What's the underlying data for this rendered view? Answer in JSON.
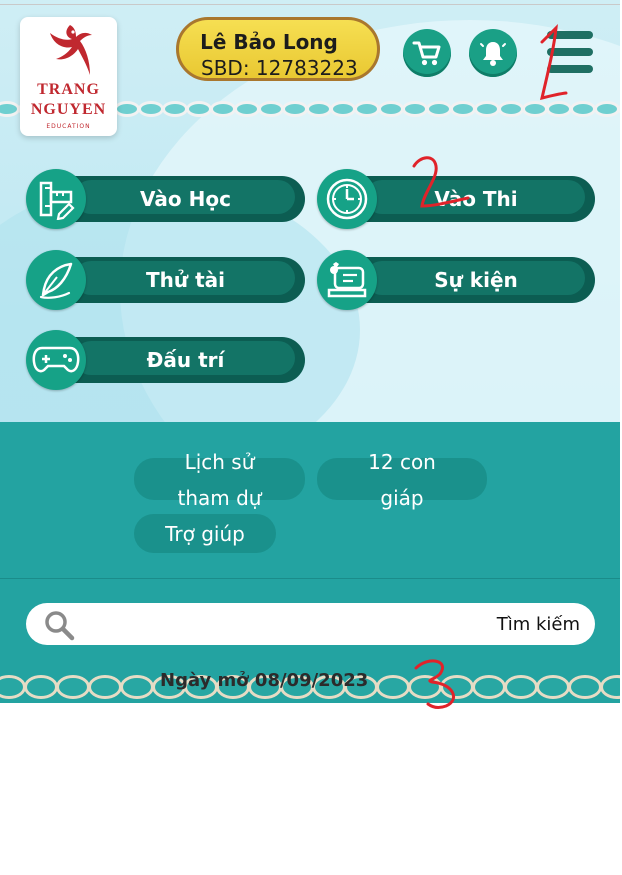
{
  "header": {
    "logo": {
      "line1": "TRANG",
      "line2": "NGUYEN",
      "line3": "EDUCATION"
    },
    "user": {
      "name": "Lê Bảo Long",
      "sbd": "SBD: 12783223"
    },
    "icons": [
      "cart-icon",
      "bell-icon",
      "hamburger-menu-icon"
    ]
  },
  "menu": {
    "items": [
      {
        "label": "Vào Học",
        "icon": "ruler-pencil-icon"
      },
      {
        "label": "Vào Thi",
        "icon": "clock-icon"
      },
      {
        "label": "Thử tài",
        "icon": "quill-icon"
      },
      {
        "label": "Sự kiện",
        "icon": "event-card-icon"
      },
      {
        "label": "Đấu trí",
        "icon": "gamepad-icon"
      }
    ]
  },
  "links": {
    "history_line1": "Lịch sử",
    "history_line2": "tham dự",
    "zodiac_line1": "12 con",
    "zodiac_line2": "giáp",
    "help": "Trợ giúp"
  },
  "search": {
    "placeholder": "Tìm kiếm"
  },
  "footer": {
    "date_text": "Ngày mở 08/09/2023"
  },
  "annotations": [
    "1",
    "2",
    "3"
  ],
  "colors": {
    "teal": "#23a3a1",
    "dark_green": "#0c5d52",
    "icon_green": "#16a287",
    "gold": "#f6df52",
    "annotation_red": "#e0232a"
  }
}
